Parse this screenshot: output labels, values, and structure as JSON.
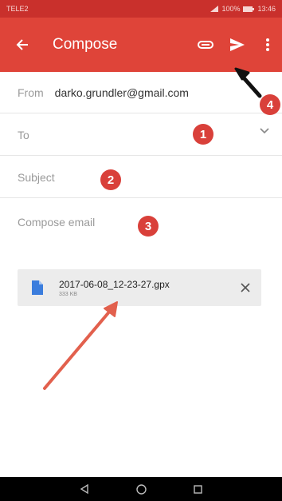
{
  "status": {
    "carrier": "TELE2",
    "battery": "100%",
    "time": "13:46"
  },
  "app_bar": {
    "title": "Compose"
  },
  "from": {
    "label": "From",
    "value": "darko.grundler@gmail.com"
  },
  "to": {
    "placeholder": "To"
  },
  "subject": {
    "placeholder": "Subject"
  },
  "body": {
    "placeholder": "Compose email"
  },
  "attachment": {
    "file_name": "2017-06-08_12-23-27.gpx",
    "file_size": "333 KB"
  },
  "annotations": {
    "badge1": "1",
    "badge2": "2",
    "badge3": "3",
    "badge4": "4"
  },
  "colors": {
    "app_bar": "#df4439",
    "status_bar": "#c9302c",
    "badge": "#d9403a",
    "file_icon": "#3b7ddd"
  },
  "icons": [
    "back-arrow-icon",
    "attach-icon",
    "send-icon",
    "more-vert-icon",
    "chevron-down-icon",
    "file-icon",
    "close-icon",
    "nav-back-icon",
    "nav-home-icon",
    "nav-recents-icon"
  ]
}
